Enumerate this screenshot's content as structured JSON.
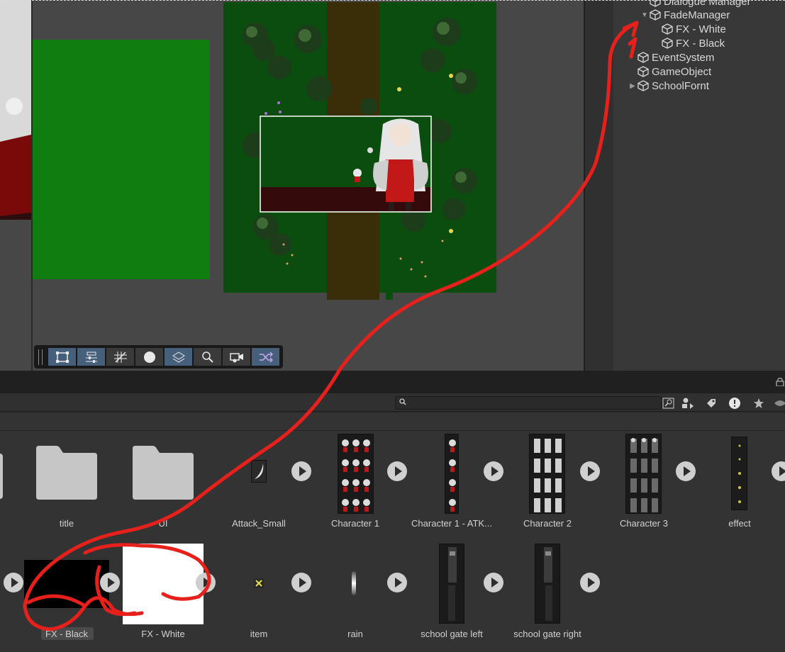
{
  "hierarchy": {
    "items": [
      {
        "label": "Dialogue Manager",
        "indent": 1,
        "arrow": ""
      },
      {
        "label": "FadeManager",
        "indent": 1,
        "arrow": "▼"
      },
      {
        "label": "FX - White",
        "indent": 2,
        "arrow": ""
      },
      {
        "label": "FX - Black",
        "indent": 2,
        "arrow": ""
      },
      {
        "label": "EventSystem",
        "indent": 0,
        "arrow": ""
      },
      {
        "label": "GameObject",
        "indent": 0,
        "arrow": ""
      },
      {
        "label": "SchoolFornt",
        "indent": 0,
        "arrow": "▶"
      }
    ]
  },
  "project": {
    "search_placeholder": "",
    "toolbar_icons": [
      "scene-search-icon",
      "filter-type-icon",
      "label-icon",
      "error-icon",
      "favorite-star-icon",
      "visibility-icon"
    ],
    "row1": [
      "title",
      "UI",
      "Attack_Small",
      "Character 1",
      "Character 1 - ATK...",
      "Character 2",
      "Character 3",
      "effect"
    ],
    "row2": [
      "FX - Black",
      "FX - White",
      "item",
      "rain",
      "school gate left",
      "school gate right"
    ]
  },
  "scene_toolbar": {
    "tools": [
      "rect-tool-icon",
      "transform-settings-icon",
      "grid-snap-icon",
      "circle-gizmo-icon",
      "layers-icon",
      "zoom-icon",
      "camera-icon",
      "shuffle-icon"
    ]
  },
  "colors": {
    "annotation": "#e8201c",
    "forest": "#0b4d0e",
    "green_panel": "#0f7d0f",
    "tool_active": "#46607c"
  }
}
